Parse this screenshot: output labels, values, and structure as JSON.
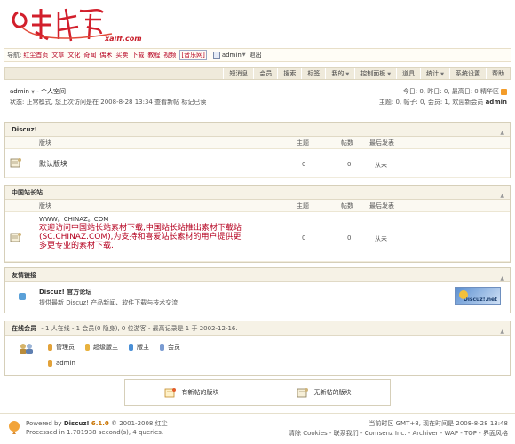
{
  "logo": {
    "brand_text": "xaiff.com"
  },
  "nav": {
    "label": "导航:",
    "links": [
      "红尘首页",
      "文章",
      "文化",
      "奇闻",
      "偶术",
      "买卖",
      "下载",
      "教程",
      "视频"
    ],
    "boxed_link": "[音乐网]",
    "user": "admin",
    "logout": "退出"
  },
  "menubar": {
    "items": [
      "短消息",
      "会员",
      "搜索",
      "标签",
      "我的",
      "控制面板",
      "道具",
      "统计",
      "系统设置",
      "帮助"
    ],
    "has_caret": [
      false,
      false,
      false,
      false,
      true,
      true,
      false,
      true,
      false,
      false
    ]
  },
  "userinfo": {
    "name": "admin",
    "space": "- 个人空间",
    "status": "状态: 正常模式, 您上次访问是在 2008-8-28 13:34  查看新帖  标记已读",
    "stats1": "今日: 0, 昨日: 0, 最高日: 0  精华区",
    "stats2_prefix": "主题: 0, 帖子: 0, 会员: 1, 欢迎新会员",
    "stats2_user": "admin"
  },
  "section1": {
    "title": "Discuz!",
    "cols": {
      "forum": "版块",
      "topics": "主题",
      "posts": "帖数",
      "last": "最后发表"
    },
    "row": {
      "name": "默认版块",
      "topics": "0",
      "posts": "0",
      "last": "从未"
    }
  },
  "section2": {
    "title": "中国站长站",
    "cols": {
      "forum": "版块",
      "topics": "主题",
      "posts": "帖数",
      "last": "最后发表"
    },
    "row": {
      "name": "WWW。CHINAZ。COM",
      "desc1": "欢迎访问中国站长站素材下载,中国站长站推出素材下载站",
      "desc2": "(SC.CHINAZ.COM),为支持和喜爱站长素材的用户提供更",
      "desc3": "多更专业的素材下载.",
      "topics": "0",
      "posts": "0",
      "last": "从未"
    }
  },
  "section3": {
    "title": "友情链接",
    "link_name": "Discuz! 官方论坛",
    "link_desc": "提供最新 Discuz! 产品新闻、软件下载与技术交流",
    "banner_text": "Discuz!.net"
  },
  "section4": {
    "title": "在线会员",
    "summary": "- 1 人在线  - 1 会员(0 隐身), 0 位游客  - 最高记录是 1 于 2002-12-16.",
    "groups": [
      "管理员",
      "超级版主",
      "版主",
      "会员"
    ],
    "group_colors": [
      "#e2a23a",
      "#e8b23e",
      "#4a8fd6",
      "#7a9bd2"
    ],
    "online_user": "admin"
  },
  "legend": {
    "new": "有新帖的版块",
    "nonew": "无新帖的版块"
  },
  "footer": {
    "powered_by": "Powered by",
    "product": "Discuz!",
    "version": "6.1.0",
    "copyright": "© 2001-2008 红尘",
    "processed": "Processed in 1.701938 second(s), 4 queries.",
    "time": "当前时区 GMT+8, 现在时间是 2008-8-28 13:48",
    "links": "清除 Cookies - 联系我们 - Comsenz Inc. - Archiver - WAP - TOP - 界面风格"
  }
}
